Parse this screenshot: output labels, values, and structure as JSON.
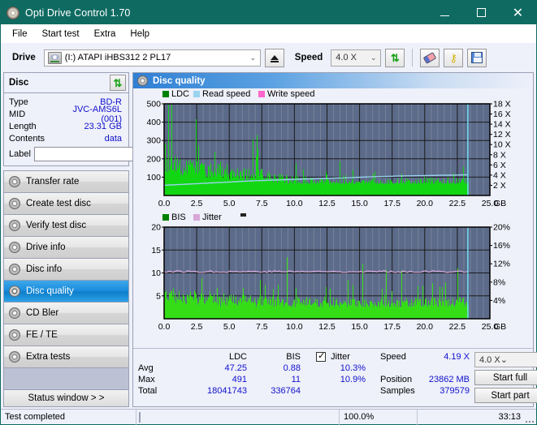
{
  "window": {
    "title": "Opti Drive Control 1.70",
    "minimize": "–",
    "maximize": "□",
    "close": "✕"
  },
  "menu": [
    "File",
    "Start test",
    "Extra",
    "Help"
  ],
  "toolbar": {
    "drive_label": "Drive",
    "drive_value": "(I:)   ATAPI iHBS312   2 PL17",
    "eject_title": "Eject",
    "speed_label": "Speed",
    "speed_value": "4.0 X",
    "refresh_icon": "refresh-icon",
    "erase_icon": "eraser-icon",
    "key_icon": "key-icon",
    "save_icon": "save-icon"
  },
  "disc": {
    "header": "Disc",
    "refresh_icon": "refresh-icon",
    "rows": [
      {
        "key": "Type",
        "value": "BD-R"
      },
      {
        "key": "MID",
        "value": "JVC-AMS6L (001)"
      },
      {
        "key": "Length",
        "value": "23.31 GB"
      },
      {
        "key": "Contents",
        "value": "data"
      }
    ],
    "label_key": "Label",
    "label_value": "",
    "label_placeholder": ""
  },
  "nav": {
    "items": [
      {
        "label": "Transfer rate",
        "active": false
      },
      {
        "label": "Create test disc",
        "active": false
      },
      {
        "label": "Verify test disc",
        "active": false
      },
      {
        "label": "Drive info",
        "active": false
      },
      {
        "label": "Disc info",
        "active": false
      },
      {
        "label": "Disc quality",
        "active": true
      },
      {
        "label": "CD Bler",
        "active": false
      },
      {
        "label": "FE / TE",
        "active": false
      },
      {
        "label": "Extra tests",
        "active": false
      }
    ],
    "status_window": "Status window > >"
  },
  "panel": {
    "title": "Disc quality"
  },
  "stats": {
    "col_ldc": "LDC",
    "col_bis": "BIS",
    "col_jitter": "Jitter",
    "jitter_checked": true,
    "rows": [
      {
        "label": "Avg",
        "ldc": "47.25",
        "bis": "0.88",
        "jitter": "10.3%"
      },
      {
        "label": "Max",
        "ldc": "491",
        "bis": "11",
        "jitter": "10.9%"
      },
      {
        "label": "Total",
        "ldc": "18041743",
        "bis": "336764",
        "jitter": ""
      }
    ],
    "speed_key": "Speed",
    "speed_value": "4.19 X",
    "position_key": "Position",
    "position_value": "23862 MB",
    "samples_key": "Samples",
    "samples_value": "379579",
    "speed_select": "4.0 X",
    "start_full": "Start full",
    "start_part": "Start part"
  },
  "statusbar": {
    "message": "Test completed",
    "percent_label": "100.0%",
    "percent_value": 100,
    "elapsed": "33:13"
  },
  "chart_data": [
    {
      "type": "area",
      "name": "ldc-chart",
      "title": "",
      "xlabel": "GB",
      "ylabel": "",
      "xlim": [
        0,
        25.0
      ],
      "ylim": [
        0,
        500
      ],
      "y2lim": [
        0,
        18
      ],
      "y2label": "X",
      "xticks": [
        "0.0",
        "2.5",
        "5.0",
        "7.5",
        "10.0",
        "12.5",
        "15.0",
        "17.5",
        "20.0",
        "22.5",
        "25.0"
      ],
      "yticks": [
        "100",
        "200",
        "300",
        "400",
        "500"
      ],
      "y2ticks": [
        "2 X",
        "4 X",
        "6 X",
        "8 X",
        "10 X",
        "12 X",
        "14 X",
        "16 X",
        "18 X"
      ],
      "x_unit": "GB",
      "grid": true,
      "plot_bg": "#5c6b8a",
      "legend": [
        {
          "label": "LDC",
          "color": "#008000"
        },
        {
          "label": "Read speed",
          "color": "#9ad4ee"
        },
        {
          "label": "Write speed",
          "color": "#ff66cc"
        }
      ],
      "data_end_gb": 23.35,
      "marker_gb": 23.31,
      "series": [
        {
          "name": "LDC",
          "color": "#13d613",
          "baseline_avg": 47.25,
          "max": 491,
          "envelope": [
            230,
            205,
            200,
            215,
            198,
            190,
            188,
            195,
            186,
            182,
            178,
            180,
            175,
            170,
            168,
            172,
            165,
            170,
            180,
            175,
            168,
            160,
            155,
            150,
            148,
            152,
            150,
            145,
            140,
            138,
            142,
            146,
            138,
            130,
            126,
            120,
            118,
            116,
            112,
            110,
            108,
            112,
            106,
            104,
            100,
            98,
            102,
            96,
            94,
            92,
            90,
            94,
            92,
            90,
            88,
            86,
            90,
            88,
            86,
            84,
            88,
            92,
            86,
            84,
            82,
            88,
            86,
            84,
            90,
            88,
            86,
            84,
            88,
            92,
            90,
            88,
            94,
            92,
            90,
            96,
            94,
            92,
            98,
            96,
            94,
            100,
            98,
            96,
            94,
            98,
            102,
            100,
            98,
            96,
            94,
            100,
            104,
            102,
            100,
            98
          ]
        },
        {
          "name": "Read speed",
          "color": "#9ad4ee",
          "values_x_ratio": [
            0.0,
            0.1,
            0.2,
            0.3,
            0.4,
            0.5,
            0.6,
            0.7,
            0.8,
            0.9,
            1.0
          ],
          "values": [
            2.0,
            2.3,
            2.6,
            2.9,
            3.1,
            3.3,
            3.5,
            3.7,
            3.85,
            3.95,
            4.05
          ]
        }
      ]
    },
    {
      "type": "area",
      "name": "bis-chart",
      "title": "",
      "xlabel": "GB",
      "ylabel": "",
      "xlim": [
        0,
        25.0
      ],
      "ylim": [
        0,
        20
      ],
      "y2lim": [
        0,
        20
      ],
      "y2label": "%",
      "xticks": [
        "0.0",
        "2.5",
        "5.0",
        "7.5",
        "10.0",
        "12.5",
        "15.0",
        "17.5",
        "20.0",
        "22.5",
        "25.0"
      ],
      "yticks": [
        "5",
        "10",
        "15",
        "20"
      ],
      "y2ticks": [
        "4%",
        "8%",
        "12%",
        "16%",
        "20%"
      ],
      "x_unit": "GB",
      "grid": true,
      "plot_bg": "#5c6b8a",
      "legend": [
        {
          "label": "BIS",
          "color": "#008000"
        },
        {
          "label": "Jitter",
          "color": "#d7a8d7"
        }
      ],
      "data_end_gb": 23.35,
      "marker_gb": 23.31,
      "series": [
        {
          "name": "BIS",
          "color": "#35dd17",
          "avg": 0.88,
          "max": 11,
          "envelope": [
            6.8,
            6.5,
            6.2,
            6.6,
            6.0,
            5.8,
            6.4,
            5.6,
            5.4,
            6.2,
            5.8,
            5.2,
            5.6,
            5.4,
            5.0,
            5.8,
            5.2,
            5.0,
            4.8,
            5.4,
            5.2,
            4.9,
            5.6,
            5.1,
            4.8,
            5.3,
            4.9,
            4.7,
            5.2,
            4.8,
            4.6,
            5.0,
            4.8,
            4.5,
            4.9,
            4.7,
            4.4,
            4.8,
            4.6,
            4.4,
            4.9,
            4.5,
            4.3,
            4.7,
            4.5,
            4.3,
            4.8,
            4.4,
            4.2,
            4.6,
            4.4,
            4.2,
            4.7,
            4.3,
            4.1,
            4.5,
            4.3,
            4.1,
            4.6,
            4.2,
            4.0,
            4.4,
            4.2,
            4.0,
            4.5,
            4.1,
            3.9,
            4.3,
            4.1,
            3.9,
            4.4,
            4.0,
            3.8,
            4.2,
            4.0,
            3.8,
            4.3,
            3.9,
            4.1,
            4.4,
            4.0,
            4.2,
            4.5,
            4.1,
            4.3,
            4.6,
            4.2,
            4.4,
            4.7,
            4.3,
            4.5,
            4.8,
            4.4,
            4.6,
            4.9,
            4.5,
            4.7,
            5.0,
            4.6,
            4.8
          ]
        },
        {
          "name": "Jitter",
          "color": "#d7a8d7",
          "avg_pct": 10.3,
          "max_pct": 10.9
        }
      ]
    }
  ]
}
